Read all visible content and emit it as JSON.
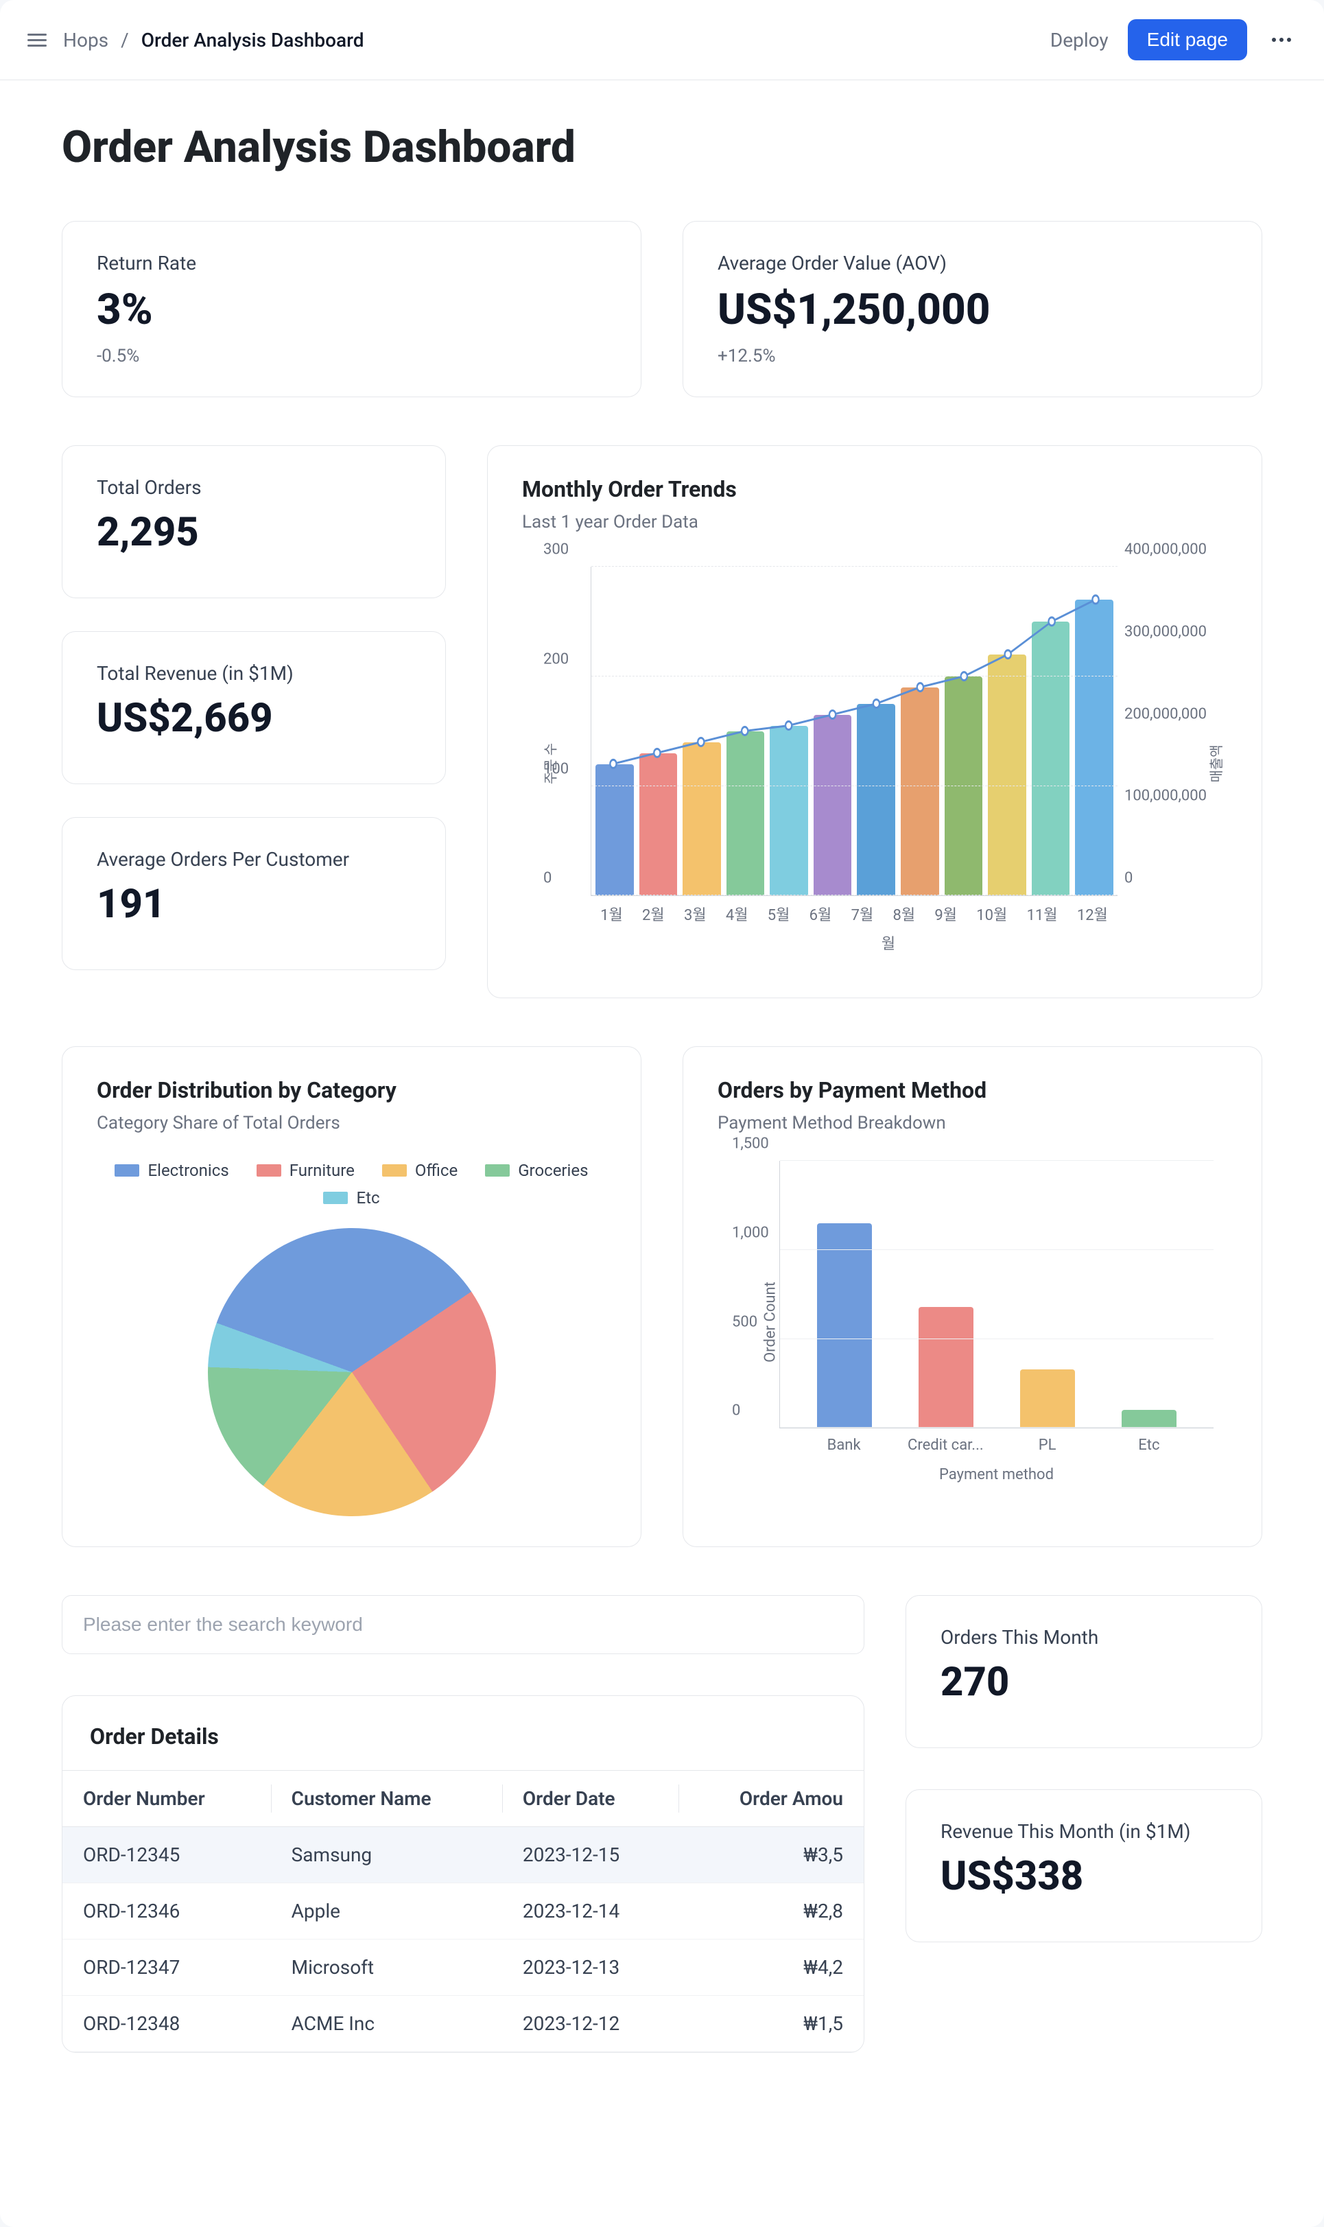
{
  "colors": {
    "c1": "#6f9bdc",
    "c2": "#ec8a86",
    "c3": "#f4c26c",
    "c4": "#85c99a",
    "c5": "#7fcde0",
    "c6": "#a78bce",
    "c7": "#5aa0d8",
    "c8": "#e7a06e",
    "c9": "#8fb96e",
    "c10": "#e6cf6f",
    "c11": "#82d1c0",
    "c12": "#6cb3e6"
  },
  "header": {
    "breadcrumb_root": "Hops",
    "breadcrumb_sep": "/",
    "breadcrumb_current": "Order Analysis Dashboard",
    "deploy": "Deploy",
    "edit_page": "Edit page"
  },
  "page_title": "Order Analysis Dashboard",
  "kpi": {
    "return_rate": {
      "label": "Return Rate",
      "value": "3%",
      "delta": "-0.5%"
    },
    "aov": {
      "label": "Average Order Value (AOV)",
      "value": "US$1,250,000",
      "delta": "+12.5%"
    },
    "total_orders": {
      "label": "Total Orders",
      "value": "2,295"
    },
    "total_revenue": {
      "label": "Total Revenue (in $1M)",
      "value": "US$2,669"
    },
    "avg_orders_cust": {
      "label": "Average Orders Per Customer",
      "value": "191"
    },
    "orders_month": {
      "label": "Orders This Month",
      "value": "270"
    },
    "revenue_month": {
      "label": "Revenue This Month (in $1M)",
      "value": "US$338"
    }
  },
  "monthly": {
    "title": "Monthly Order Trends",
    "subtitle": "Last 1 year Order Data",
    "xlabel": "월",
    "ylabel_left": "주문 수",
    "ylabel_right": "매출액",
    "yticks_left": [
      "0",
      "100",
      "200",
      "300"
    ],
    "yticks_right": [
      "0",
      "100,000,000",
      "200,000,000",
      "300,000,000",
      "400,000,000"
    ]
  },
  "pie": {
    "title": "Order Distribution by Category",
    "subtitle": "Category Share of Total Orders",
    "legend": [
      "Electronics",
      "Furniture",
      "Office",
      "Groceries",
      "Etc"
    ]
  },
  "payment": {
    "title": "Orders by Payment Method",
    "subtitle": "Payment Method Breakdown",
    "ylabel": "Order Count",
    "xlabel": "Payment method",
    "yticks": [
      "0",
      "500",
      "1,000",
      "1,500"
    ],
    "categories": [
      "Bank",
      "Credit car...",
      "PL",
      "Etc"
    ]
  },
  "search_placeholder": "Please enter the search keyword",
  "table": {
    "title": "Order Details",
    "headers": [
      "Order Number",
      "Customer Name",
      "Order Date",
      "Order Amou"
    ],
    "rows": [
      {
        "n": "ORD-12345",
        "c": "Samsung",
        "d": "2023-12-15",
        "a": "₩3,5"
      },
      {
        "n": "ORD-12346",
        "c": "Apple",
        "d": "2023-12-14",
        "a": "₩2,8"
      },
      {
        "n": "ORD-12347",
        "c": "Microsoft",
        "d": "2023-12-13",
        "a": "₩4,2"
      },
      {
        "n": "ORD-12348",
        "c": "ACME Inc",
        "d": "2023-12-12",
        "a": "₩1,5"
      }
    ]
  },
  "chart_data": [
    {
      "type": "bar",
      "name": "monthly_order_trends",
      "title": "Monthly Order Trends",
      "categories": [
        "1월",
        "2월",
        "3월",
        "4월",
        "5월",
        "6월",
        "7월",
        "8월",
        "9월",
        "10월",
        "11월",
        "12월"
      ],
      "series": [
        {
          "name": "주문 수",
          "axis": "left",
          "values": [
            120,
            130,
            140,
            150,
            155,
            165,
            175,
            190,
            200,
            220,
            250,
            270
          ]
        },
        {
          "name": "매출액",
          "axis": "right",
          "values": [
            150000000,
            165000000,
            180000000,
            195000000,
            205000000,
            220000000,
            235000000,
            255000000,
            275000000,
            300000000,
            325000000,
            350000000
          ]
        }
      ],
      "xlabel": "월",
      "ylabel_left": "주문 수",
      "ylabel_right": "매출액",
      "ylim_left": [
        0,
        300
      ],
      "ylim_right": [
        0,
        400000000
      ]
    },
    {
      "type": "pie",
      "name": "order_distribution_by_category",
      "title": "Order Distribution by Category",
      "series": [
        {
          "name": "Electronics",
          "value": 35,
          "color": "#6f9bdc"
        },
        {
          "name": "Furniture",
          "value": 25,
          "color": "#ec8a86"
        },
        {
          "name": "Office",
          "value": 20,
          "color": "#f4c26c"
        },
        {
          "name": "Groceries",
          "value": 15,
          "color": "#85c99a"
        },
        {
          "name": "Etc",
          "value": 5,
          "color": "#7fcde0"
        }
      ]
    },
    {
      "type": "bar",
      "name": "orders_by_payment_method",
      "title": "Orders by Payment Method",
      "categories": [
        "Bank",
        "Credit card",
        "PL",
        "Etc"
      ],
      "values": [
        1150,
        680,
        330,
        100
      ],
      "colors": [
        "#6f9bdc",
        "#ec8a86",
        "#f4c26c",
        "#85c99a"
      ],
      "xlabel": "Payment method",
      "ylabel": "Order Count",
      "ylim": [
        0,
        1500
      ]
    }
  ]
}
